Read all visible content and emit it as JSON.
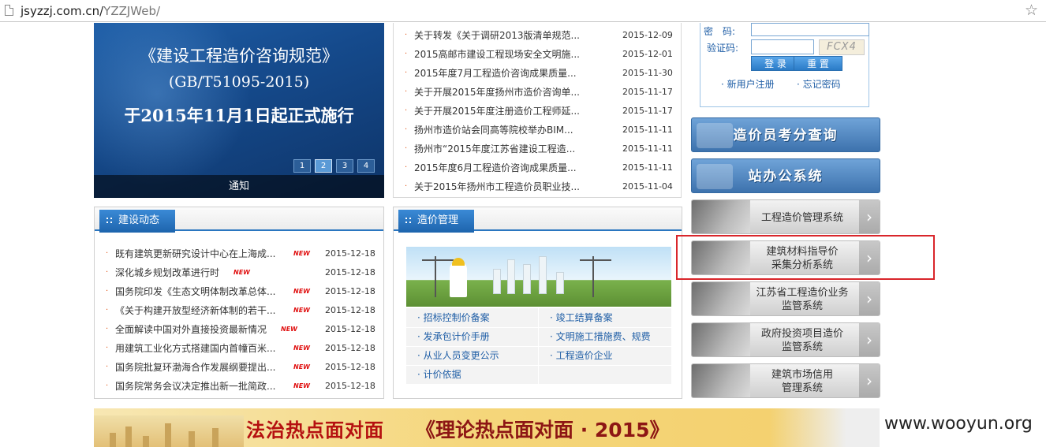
{
  "browser": {
    "url_host": "jsyzzj.com.cn/",
    "url_path": "YZZJWeb/"
  },
  "slider": {
    "line1": "《建设工程造价咨询规范》",
    "line2": "(GB/T51095-2015)",
    "line3": "于2015年11月1日起正式施行",
    "caption": "通知",
    "pages": [
      "1",
      "2",
      "3",
      "4"
    ],
    "active_page": 2
  },
  "top_news": [
    {
      "title": "关于转发《关于调研2013版清单规范...",
      "date": "2015-12-09"
    },
    {
      "title": "2015高邮市建设工程现场安全文明施...",
      "date": "2015-12-01"
    },
    {
      "title": "2015年度7月工程造价咨询成果质量...",
      "date": "2015-11-30"
    },
    {
      "title": "关于开展2015年度扬州市造价咨询单...",
      "date": "2015-11-17"
    },
    {
      "title": "关于开展2015年度注册造价工程师延...",
      "date": "2015-11-17"
    },
    {
      "title": "扬州市造价站会同高等院校举办BIM...",
      "date": "2015-11-11"
    },
    {
      "title": "扬州市“2015年度江苏省建设工程造...",
      "date": "2015-11-11"
    },
    {
      "title": "2015年度6月工程造价咨询成果质量...",
      "date": "2015-11-11"
    },
    {
      "title": "关于2015年扬州市工程造价员职业技...",
      "date": "2015-11-04"
    }
  ],
  "construction_news": {
    "tab_label": "建设动态",
    "new_badge": "NEW",
    "items": [
      {
        "title": "既有建筑更新研究设计中心在上海成...",
        "date": "2015-12-18",
        "is_new": true
      },
      {
        "title": "深化城乡规划改革进行时",
        "date": "2015-12-18",
        "is_new": true
      },
      {
        "title": "国务院印发《生态文明体制改革总体...",
        "date": "2015-12-18",
        "is_new": true
      },
      {
        "title": "《关于构建开放型经济新体制的若干...",
        "date": "2015-12-18",
        "is_new": true
      },
      {
        "title": "全面解读中国对外直接投资最新情况",
        "date": "2015-12-18",
        "is_new": true
      },
      {
        "title": "用建筑工业化方式搭建国内首幢百米...",
        "date": "2015-12-18",
        "is_new": true
      },
      {
        "title": "国务院批复环渤海合作发展纲要提出...",
        "date": "2015-12-18",
        "is_new": true
      },
      {
        "title": "国务院常务会议决定推出新一批简政...",
        "date": "2015-12-18",
        "is_new": true
      }
    ]
  },
  "cost_management": {
    "tab_label": "造价管理",
    "links": [
      "招标控制价备案",
      "竣工结算备案",
      "发承包计价手册",
      "文明施工措施费、规费",
      "从业人员变更公示",
      "工程造价企业",
      "计价依据"
    ]
  },
  "login": {
    "password_label": "密　码:",
    "captcha_label": "验证码:",
    "captcha_text": "FCX4",
    "login_button": "登 录",
    "reset_button": "重 置",
    "register_link": "新用户注册",
    "forgot_link": "忘记密码"
  },
  "systems": [
    {
      "style": "blue",
      "lines": [
        "造价员考分查询"
      ]
    },
    {
      "style": "blue",
      "lines": [
        "站办公系统"
      ]
    },
    {
      "style": "gray",
      "lines": [
        "工程造价管理系统"
      ]
    },
    {
      "style": "gray",
      "lines": [
        "建筑材料指导价",
        "采集分析系统"
      ]
    },
    {
      "style": "gray",
      "lines": [
        "江苏省工程造价业务",
        "监管系统"
      ]
    },
    {
      "style": "gray",
      "lines": [
        "政府投资项目造价",
        "监管系统"
      ]
    },
    {
      "style": "gray",
      "lines": [
        "建筑市场信用",
        "管理系统"
      ]
    }
  ],
  "bottom_banner": {
    "text1": "法治热点面对面",
    "text2": "《理论热点面对面 · 2015》"
  },
  "watermark": "www.wooyun.org",
  "colors": {
    "highlight_box": "#d9262b",
    "link_blue": "#1f5ea6",
    "bullet": "#e05010",
    "new_badge": "#e01010",
    "tab_blue": "#2a76c0"
  },
  "icons": {
    "page": "page-icon",
    "star": "bookmark-star-icon",
    "chevron": "chevron-right-icon"
  }
}
